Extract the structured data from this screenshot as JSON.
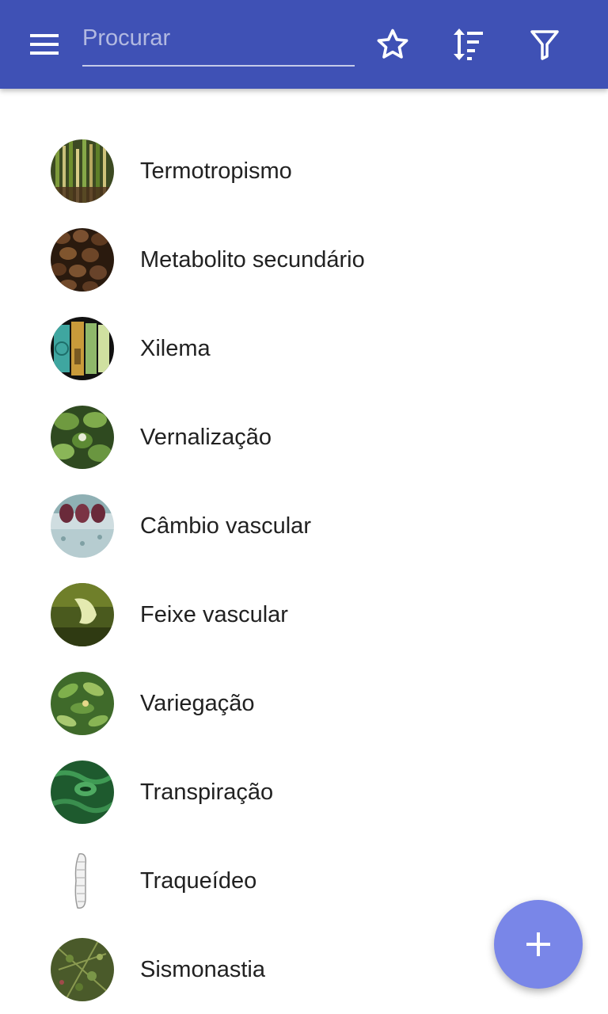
{
  "header": {
    "search": {
      "placeholder": "Procurar",
      "value": ""
    },
    "icons": {
      "menu": "menu-icon",
      "favorites": "star-outline-icon",
      "sort": "sort-icon",
      "filter": "filter-icon"
    }
  },
  "items": [
    {
      "label": "Termotropismo",
      "thumbnail": "plants-photo"
    },
    {
      "label": "Metabolito secundário",
      "thumbnail": "coffee-beans-photo"
    },
    {
      "label": "Xilema",
      "thumbnail": "xylem-micrograph"
    },
    {
      "label": "Vernalização",
      "thumbnail": "leafy-plant-photo"
    },
    {
      "label": "Câmbio vascular",
      "thumbnail": "stem-cross-section-micrograph"
    },
    {
      "label": "Feixe vascular",
      "thumbnail": "vascular-bundle-photo"
    },
    {
      "label": "Variegação",
      "thumbnail": "variegated-leaves-photo"
    },
    {
      "label": "Transpiração",
      "thumbnail": "stoma-micrograph"
    },
    {
      "label": "Traqueídeo",
      "thumbnail": "tracheid-drawing"
    },
    {
      "label": "Sismonastia",
      "thumbnail": "mimosa-photo"
    }
  ],
  "fab": {
    "icon": "plus-icon"
  },
  "colors": {
    "toolbar": "#3f51b5",
    "fab": "#7986e8",
    "text": "#212121"
  }
}
